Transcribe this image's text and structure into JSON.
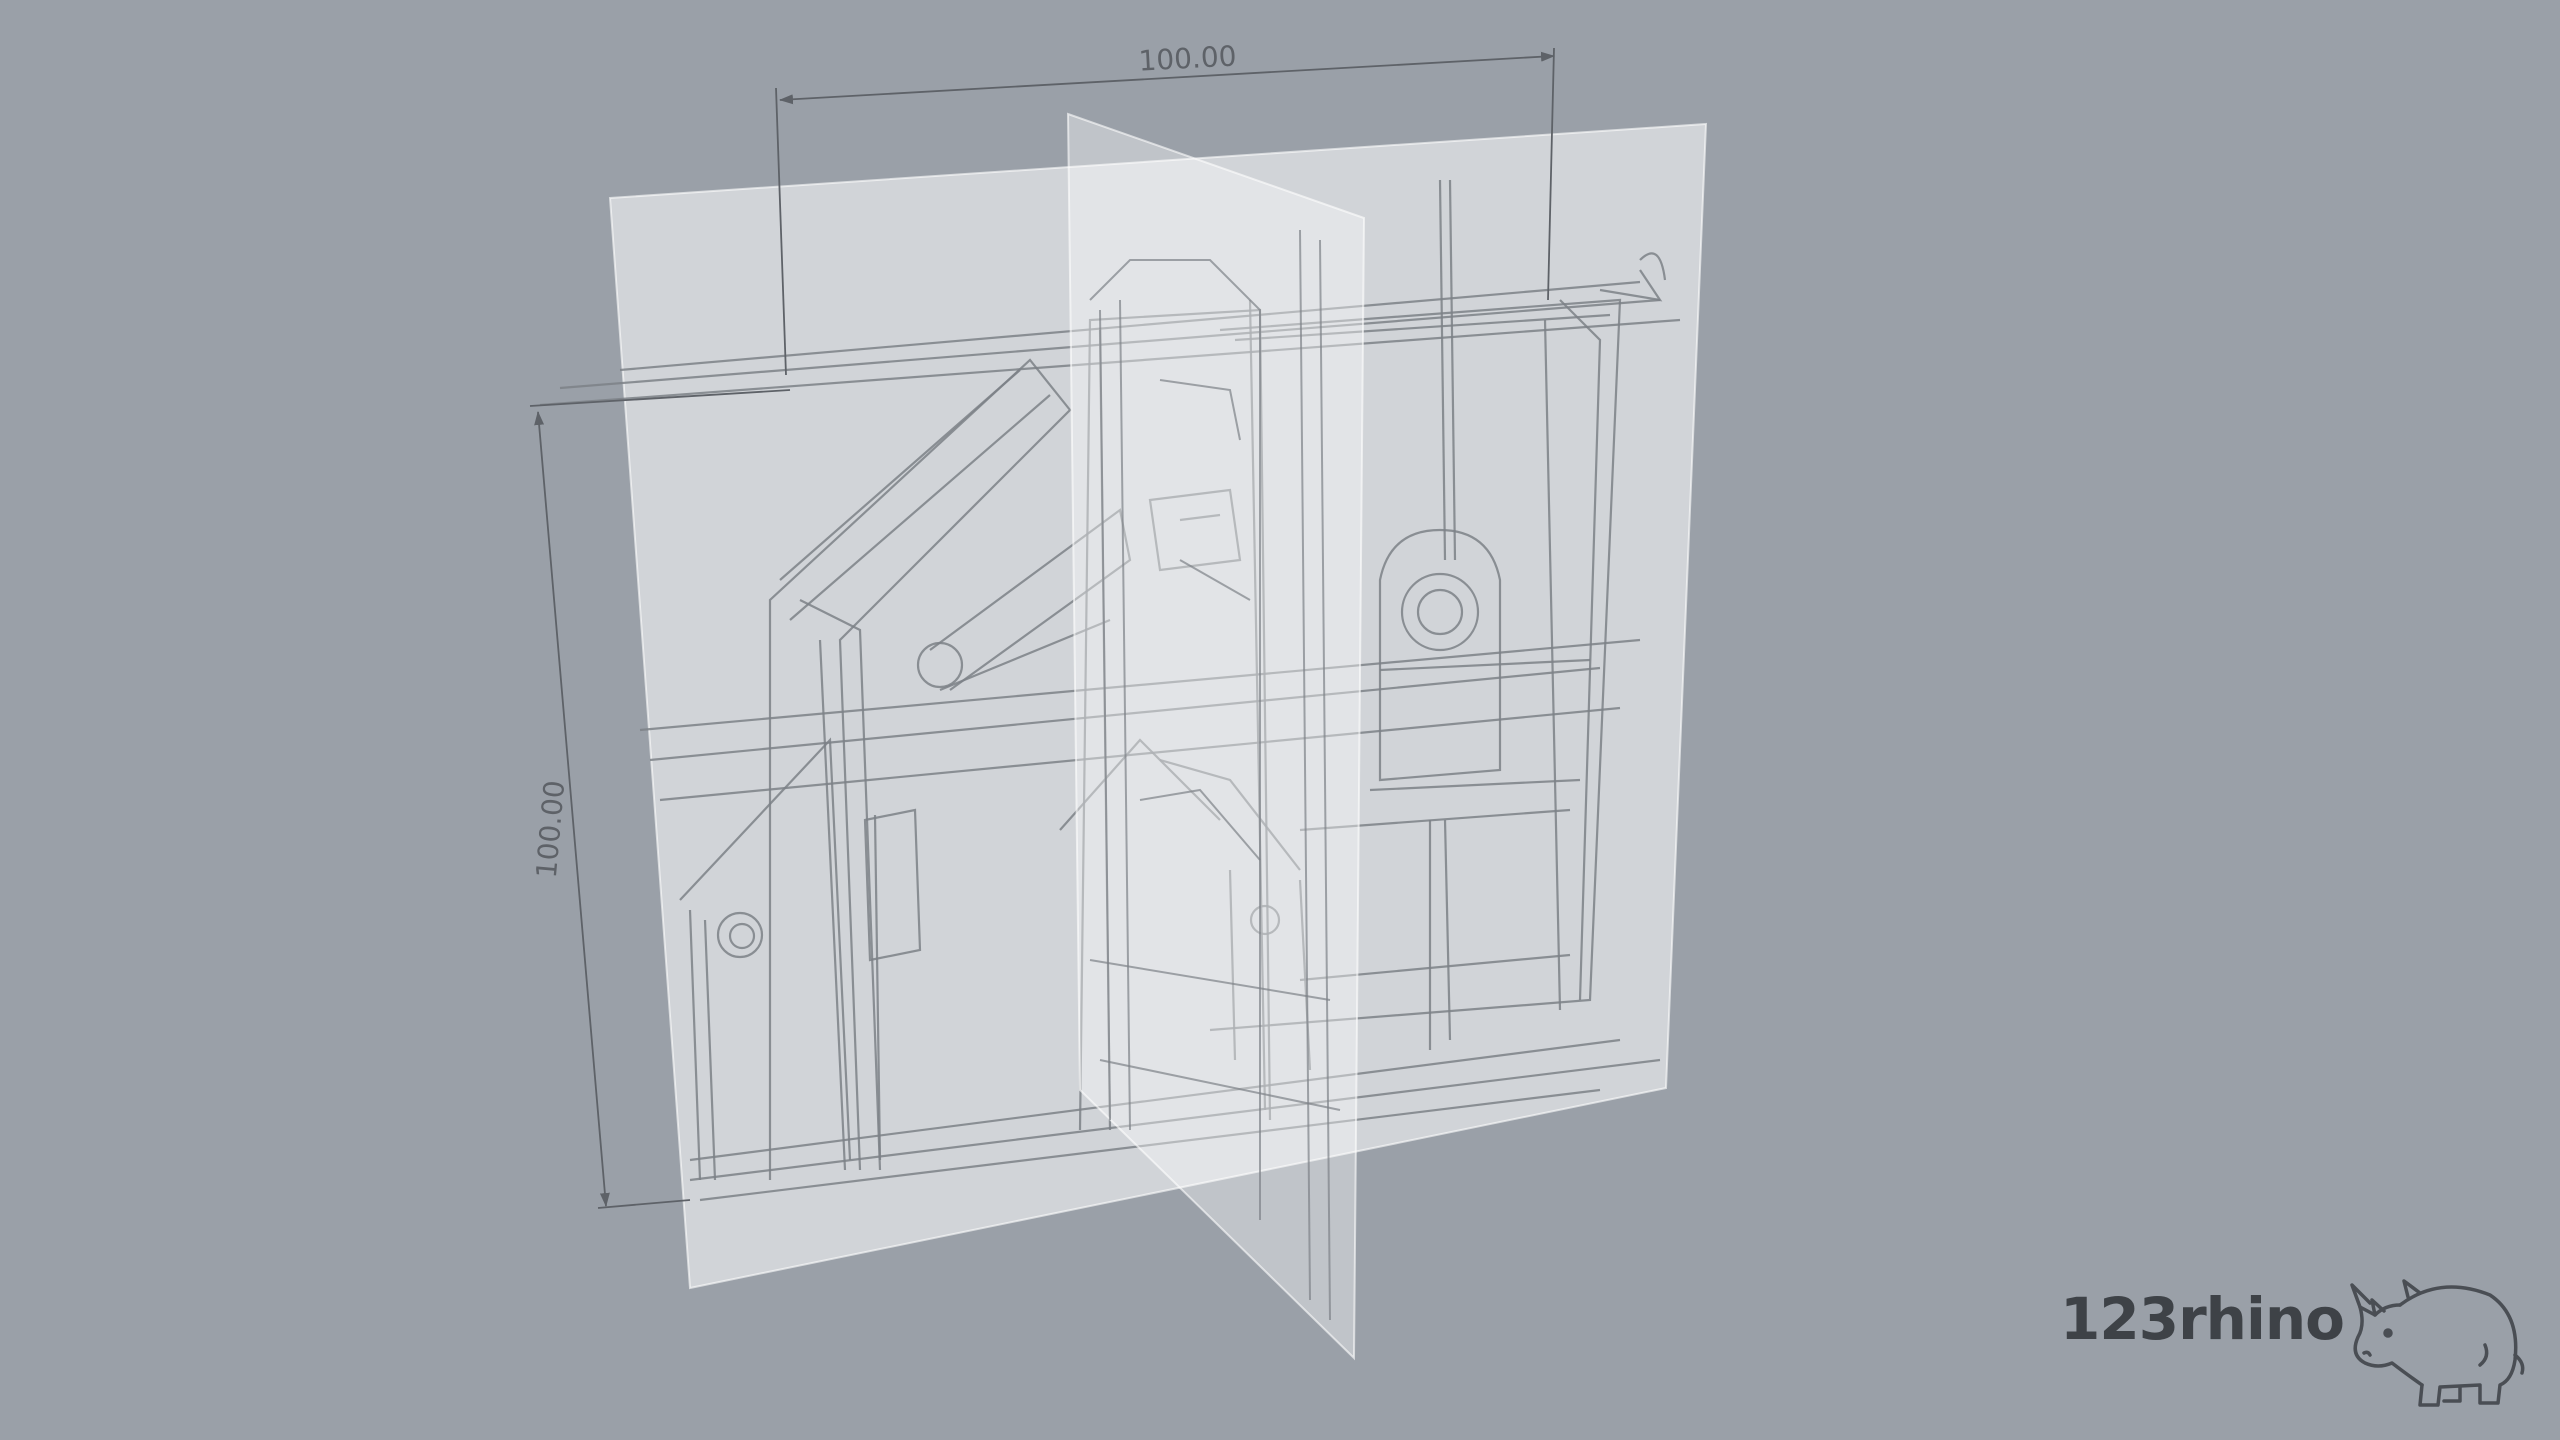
{
  "viewport": {
    "background": "#9aa0a8",
    "plane_fill": "#ffffff",
    "sketch_color": "#7d8187",
    "dimension_color": "#5e6268"
  },
  "dimensions": {
    "width_label": "100.00",
    "height_label": "100.00"
  },
  "brand": {
    "name": "123rhino",
    "logo_icon": "rhino-icon"
  }
}
